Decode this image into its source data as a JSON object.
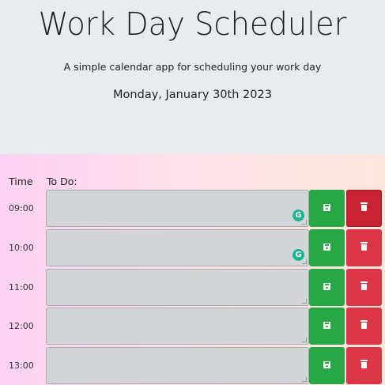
{
  "header": {
    "title": "Work Day Scheduler",
    "subtitle": "A simple calendar app for scheduling your work day",
    "date": "Monday, January 30th 2023"
  },
  "columns": {
    "time": "Time",
    "todo": "To Do:"
  },
  "rows": [
    {
      "hour": "09:00",
      "task": ""
    },
    {
      "hour": "10:00",
      "task": ""
    },
    {
      "hour": "11:00",
      "task": ""
    },
    {
      "hour": "12:00",
      "task": ""
    },
    {
      "hour": "13:00",
      "task": ""
    }
  ],
  "icons": {
    "save": "floppy-disk-icon",
    "delete": "trash-icon",
    "extension": "grammarly-icon"
  },
  "colors": {
    "save": "#27a844",
    "delete": "#dc3646",
    "task_bg": "#d4d5d8"
  }
}
